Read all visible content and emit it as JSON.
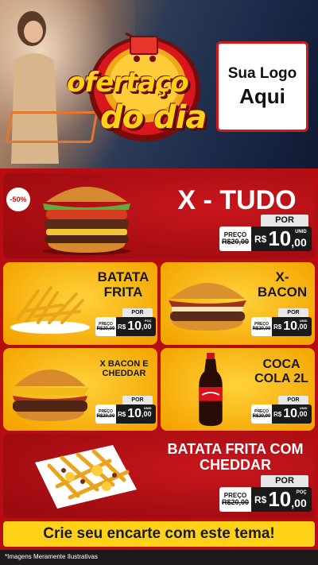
{
  "header": {
    "campaign_title_line1": "ofertaço",
    "campaign_title_line2": "do dia",
    "brand_placeholder_line1": "Sua Logo",
    "brand_placeholder_line2": "Aqui"
  },
  "discount_badge": "-50%",
  "products": [
    {
      "name": "X - TUDO",
      "por": "POR",
      "preco_label": "PREÇO",
      "old_price": "R$20,00",
      "currency": "R$",
      "price_int": "10",
      "price_dec": ",00",
      "unit": "UNID"
    },
    {
      "name": "BATATA FRITA",
      "por": "POR",
      "preco_label": "PREÇO",
      "old_price": "R$20,00",
      "currency": "R$",
      "price_int": "10",
      "price_dec": ",00",
      "unit": "POÇ"
    },
    {
      "name": "X- BACON",
      "por": "POR",
      "preco_label": "PREÇO",
      "old_price": "R$20,00",
      "currency": "R$",
      "price_int": "10",
      "price_dec": ",00",
      "unit": "UNID"
    },
    {
      "name": "X BACON E CHEDDAR",
      "por": "POR",
      "preco_label": "PREÇO",
      "old_price": "R$20,00",
      "currency": "R$",
      "price_int": "10",
      "price_dec": ",00",
      "unit": "UNID"
    },
    {
      "name": "COCA COLA 2L",
      "por": "POR",
      "preco_label": "PREÇO",
      "old_price": "R$20,00",
      "currency": "R$",
      "price_int": "10",
      "price_dec": ",00",
      "unit": "UNID"
    },
    {
      "name": "BATATA FRITA COM CHEDDAR",
      "por": "POR",
      "preco_label": "PREÇO",
      "old_price": "R$20,00",
      "currency": "R$",
      "price_int": "10",
      "price_dec": ",00",
      "unit": "POÇ"
    }
  ],
  "cta_text": "Crie seu encarte com este tema!",
  "disclaimer": "*Imagens Meramente Ilustrativas",
  "colors": {
    "primary_red": "#b70c11",
    "accent_yellow": "#ffd21a",
    "price_black": "#1a1a1a"
  }
}
